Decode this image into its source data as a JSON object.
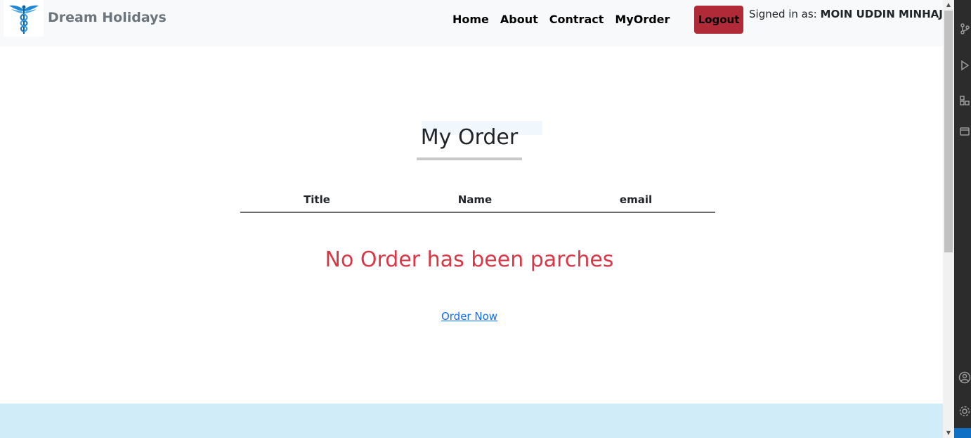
{
  "header": {
    "brand": "Dream Holidays",
    "nav": [
      "Home",
      "About",
      "Contract",
      "MyOrder"
    ],
    "logout_label": "Logout",
    "signed_in_prefix": "Signed in as:",
    "user_name": "MOIN UDDIN MINHAJ"
  },
  "main": {
    "title": "My Order",
    "table_headers": [
      "Title",
      "Name",
      "email"
    ],
    "empty_message": "No Order has been parches",
    "order_link": "Order Now"
  },
  "colors": {
    "navbar_bg": "#f8f9fa",
    "logout_bg": "#b02a37",
    "empty_message": "#dc3545",
    "link": "#0d6efd",
    "footer_band": "#d0ecf8"
  },
  "icons": {
    "logo": "caduceus-icon",
    "activity_bar": [
      "source-control-icon",
      "run-debug-icon",
      "extensions-icon",
      "remote-explorer-icon",
      "account-icon",
      "settings-gear-icon"
    ]
  }
}
